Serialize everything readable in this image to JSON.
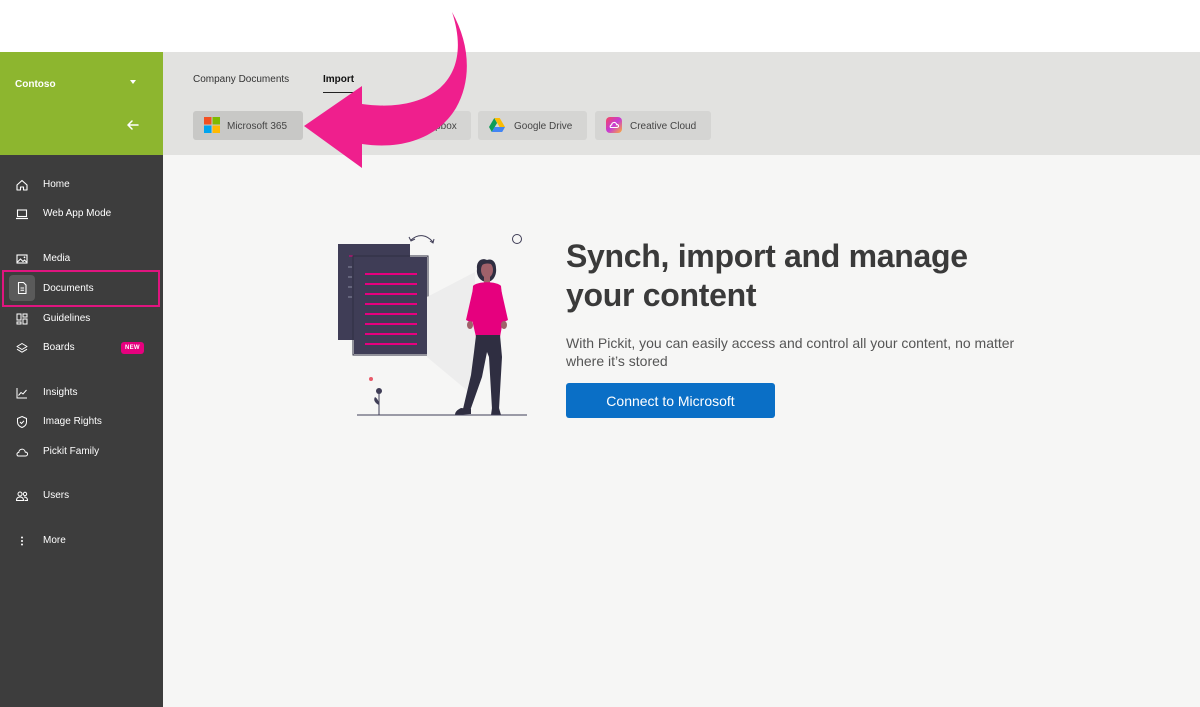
{
  "sidebar": {
    "org_name": "Contoso",
    "items": [
      {
        "label": "Home",
        "icon": "home-icon"
      },
      {
        "label": "Web App Mode",
        "icon": "laptop-icon"
      },
      {
        "label": "Media",
        "icon": "image-icon"
      },
      {
        "label": "Documents",
        "icon": "document-icon",
        "active": true
      },
      {
        "label": "Guidelines",
        "icon": "guidelines-icon"
      },
      {
        "label": "Boards",
        "icon": "boards-icon",
        "badge": "NEW"
      },
      {
        "label": "Insights",
        "icon": "chart-icon"
      },
      {
        "label": "Image Rights",
        "icon": "shield-icon"
      },
      {
        "label": "Pickit Family",
        "icon": "cloud-icon"
      },
      {
        "label": "Users",
        "icon": "users-icon"
      },
      {
        "label": "More",
        "icon": "more-vertical-icon"
      }
    ]
  },
  "tabs": [
    {
      "label": "Company Documents"
    },
    {
      "label": "Import",
      "active": true
    }
  ],
  "sources": [
    {
      "label": "Microsoft 365",
      "icon": "microsoft-icon",
      "selected": true
    },
    {
      "label": "Dropbox",
      "icon": "dropbox-icon"
    },
    {
      "label": "Google Drive",
      "icon": "google-drive-icon"
    },
    {
      "label": "Creative Cloud",
      "icon": "creative-cloud-icon"
    }
  ],
  "main": {
    "headline": "Synch, import and manage your content",
    "subtext": "With Pickit, you can easily access and control all your content, no matter where it’s stored",
    "cta_label": "Connect to Microsoft"
  },
  "colors": {
    "brand_green": "#8db62f",
    "sidebar_bg": "#3d3d3d",
    "accent_pink": "#e6007e",
    "cta_blue": "#0a6fc6"
  }
}
